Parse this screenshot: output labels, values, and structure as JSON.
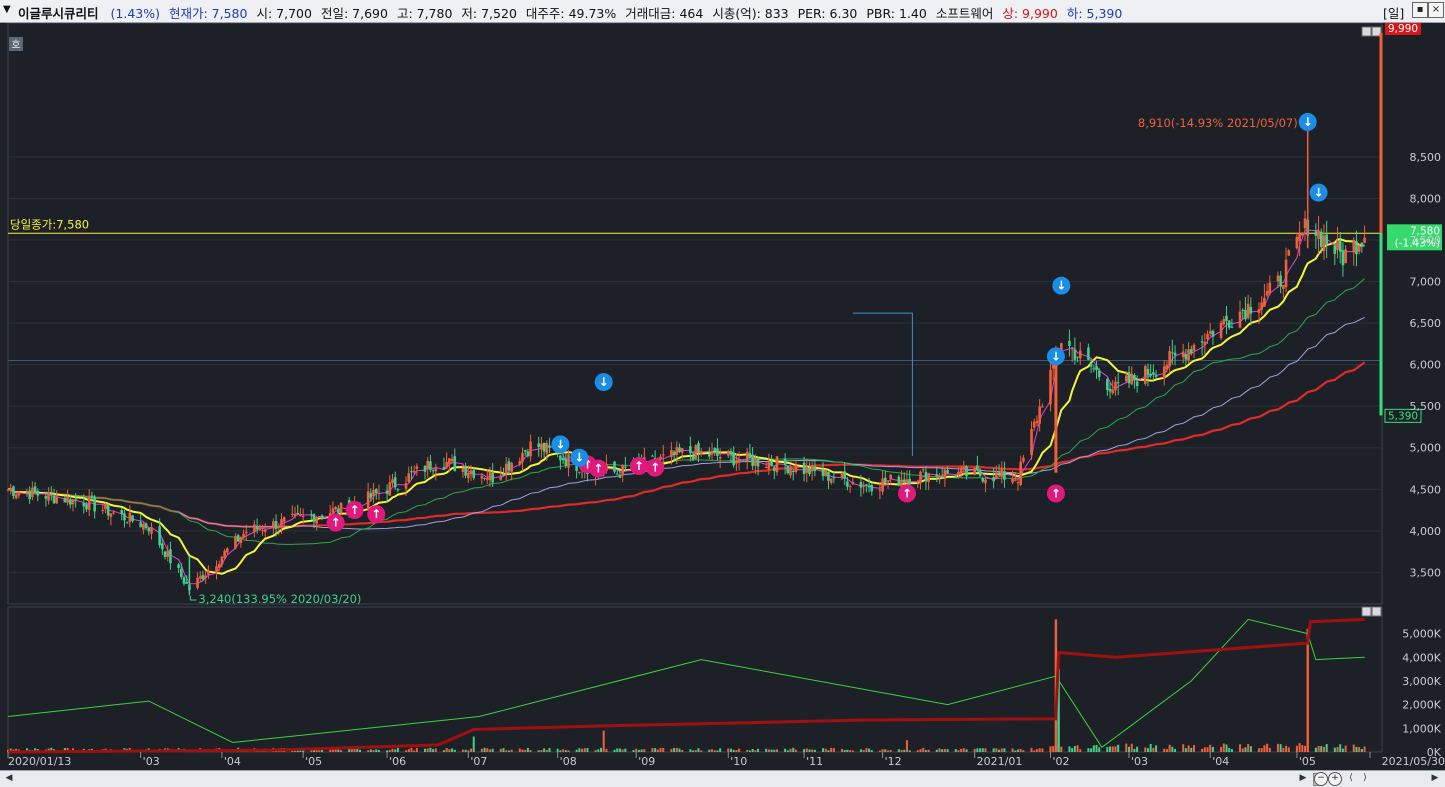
{
  "header": {
    "fields": [
      {
        "text": "이글루시큐리티",
        "color": "#111111"
      },
      {
        "text": "(1.43%)",
        "color": "#1f3db0"
      },
      {
        "text": "현재가: 7,580",
        "color": "#1f3db0"
      },
      {
        "text": "시: 7,700",
        "color": "#111111"
      },
      {
        "text": "전일: 7,690",
        "color": "#111111"
      },
      {
        "text": "고: 7,780",
        "color": "#111111"
      },
      {
        "text": "저: 7,520",
        "color": "#111111"
      },
      {
        "text": "대주주: 49.73%",
        "color": "#111111"
      },
      {
        "text": "거래대금: 464",
        "color": "#111111"
      },
      {
        "text": "시총(억): 833",
        "color": "#111111"
      },
      {
        "text": "PER: 6.30",
        "color": "#111111"
      },
      {
        "text": "PBR: 1.40",
        "color": "#111111"
      },
      {
        "text": "소프트웨어",
        "color": "#111111"
      },
      {
        "text": "상: 9,990",
        "color": "#d11717"
      },
      {
        "text": "하: 5,390",
        "color": "#1f3db0"
      }
    ],
    "period_button": "[일]",
    "left_icon": "chevron-down-icon"
  },
  "price_panel": {
    "mode_badge": "호",
    "close_line_label": "당일종가:7,580",
    "y_ticks": [
      3500,
      4000,
      4500,
      5000,
      5500,
      6000,
      6500,
      7000,
      7500,
      8000,
      8500
    ],
    "y_tick_labels": [
      "3,500",
      "4,000",
      "4,500",
      "5,000",
      "5,500",
      "6,000",
      "6,500",
      "7,000",
      "7,500",
      "8,000",
      "8,500"
    ],
    "ylim": [
      3120,
      9990
    ],
    "upper_limit_tag": "9,990",
    "lower_limit_tag": "5,390",
    "current_tag": "7,580",
    "current_change_tag": "(-1.43%)",
    "high_annotation": "8,910(-14.93% 2021/05/07)",
    "low_annotation": "3,240(133.95% 2020/03/20)",
    "colors": {
      "up": "#f0603a",
      "down": "#40d08a",
      "ma5": "#e040e0",
      "ma20": "#f5f53a",
      "ma60": "#2aa84a",
      "ma120": "#a0a0e0",
      "ma240": "#e02a2a",
      "close_line": "#f5f53a",
      "grid": "#394049"
    }
  },
  "volume_panel": {
    "y_ticks": [
      0,
      1000,
      2000,
      3000,
      4000,
      5000
    ],
    "y_tick_labels": [
      "0K",
      "1,000K",
      "2,000K",
      "3,000K",
      "4,000K",
      "5,000K"
    ],
    "ylim": [
      0,
      5700
    ]
  },
  "x_axis": {
    "labels": [
      "2020/01/13",
      "'03",
      "'04",
      "'05",
      "'06",
      "'07",
      "'08",
      "'09",
      "'10",
      "'11",
      "'12",
      "2021/01",
      "'02",
      "'03",
      "'04",
      "'05",
      "2021/05/30"
    ]
  },
  "chart_data": {
    "type": "candlestick",
    "title": "이글루시큐리티",
    "period": "daily",
    "x_range": [
      "2020/01/13",
      "2021/05/30"
    ],
    "price_keypoints": [
      {
        "date": "2020/01/13",
        "close": 4500
      },
      {
        "date": "2020/02/10",
        "close": 4350
      },
      {
        "date": "2020/03/05",
        "close": 4050
      },
      {
        "date": "2020/03/20",
        "close": 3300
      },
      {
        "date": "2020/04/10",
        "close": 4000
      },
      {
        "date": "2020/05/20",
        "close": 4300
      },
      {
        "date": "2020/06/20",
        "close": 4850
      },
      {
        "date": "2020/07/10",
        "close": 4650
      },
      {
        "date": "2020/07/25",
        "close": 5050
      },
      {
        "date": "2020/08/10",
        "close": 4800
      },
      {
        "date": "2020/08/25",
        "close": 4700
      },
      {
        "date": "2020/09/20",
        "close": 4950
      },
      {
        "date": "2020/10/25",
        "close": 4800
      },
      {
        "date": "2020/11/25",
        "close": 4550
      },
      {
        "date": "2020/12/20",
        "close": 4700
      },
      {
        "date": "2021/01/20",
        "close": 4650
      },
      {
        "date": "2021/02/05",
        "close": 6300
      },
      {
        "date": "2021/02/25",
        "close": 5700
      },
      {
        "date": "2021/03/20",
        "close": 6100
      },
      {
        "date": "2021/04/10",
        "close": 6600
      },
      {
        "date": "2021/04/25",
        "close": 6900
      },
      {
        "date": "2021/05/07",
        "close": 7700
      },
      {
        "date": "2021/05/20",
        "close": 7300
      },
      {
        "date": "2021/05/28",
        "close": 7580
      }
    ],
    "high": {
      "date": "2021/05/07",
      "value": 8910
    },
    "low": {
      "date": "2020/03/20",
      "value": 3240
    },
    "current": 7580,
    "moving_averages": [
      "ma5",
      "ma20",
      "ma60",
      "ma120",
      "ma240"
    ],
    "buy_signals": [
      "2020/05/13",
      "2020/05/20",
      "2020/05/28",
      "2020/08/14",
      "2020/08/18",
      "2020/09/02",
      "2020/09/08",
      "2020/12/10",
      "2021/02/03"
    ],
    "sell_signals": [
      "2020/08/04",
      "2020/08/11",
      "2020/08/20",
      "2021/02/05",
      "2021/02/03",
      "2021/05/07",
      "2021/05/11"
    ],
    "volume_keypoints_k": [
      {
        "date": "2021/02/03",
        "value": 5600
      },
      {
        "date": "2021/02/04",
        "value": 3500
      },
      {
        "date": "2021/05/07",
        "value": 5200
      }
    ],
    "obv_line_k": [
      {
        "date": "2020/01/13",
        "value": 1500
      },
      {
        "date": "2020/03/05",
        "value": 2150
      },
      {
        "date": "2020/04/05",
        "value": 400
      },
      {
        "date": "2020/07/05",
        "value": 1500
      },
      {
        "date": "2020/09/25",
        "value": 3900
      },
      {
        "date": "2020/12/25",
        "value": 2000
      },
      {
        "date": "2021/02/03",
        "value": 3200
      },
      {
        "date": "2021/02/20",
        "value": 200
      },
      {
        "date": "2021/03/25",
        "value": 3000
      },
      {
        "date": "2021/04/15",
        "value": 5600
      },
      {
        "date": "2021/05/07",
        "value": 5000
      },
      {
        "date": "2021/05/10",
        "value": 3900
      },
      {
        "date": "2021/05/28",
        "value": 4000
      }
    ],
    "cum_volume_line_k": [
      {
        "date": "2020/01/13",
        "value": 0
      },
      {
        "date": "2020/04/20",
        "value": 80
      },
      {
        "date": "2020/06/20",
        "value": 300
      },
      {
        "date": "2020/07/03",
        "value": 950
      },
      {
        "date": "2020/08/20",
        "value": 1100
      },
      {
        "date": "2020/11/25",
        "value": 1350
      },
      {
        "date": "2021/02/03",
        "value": 1400
      },
      {
        "date": "2021/02/04",
        "value": 4200
      },
      {
        "date": "2021/02/25",
        "value": 4000
      },
      {
        "date": "2021/05/07",
        "value": 4600
      },
      {
        "date": "2021/05/08",
        "value": 5500
      },
      {
        "date": "2021/05/28",
        "value": 5600
      }
    ]
  }
}
